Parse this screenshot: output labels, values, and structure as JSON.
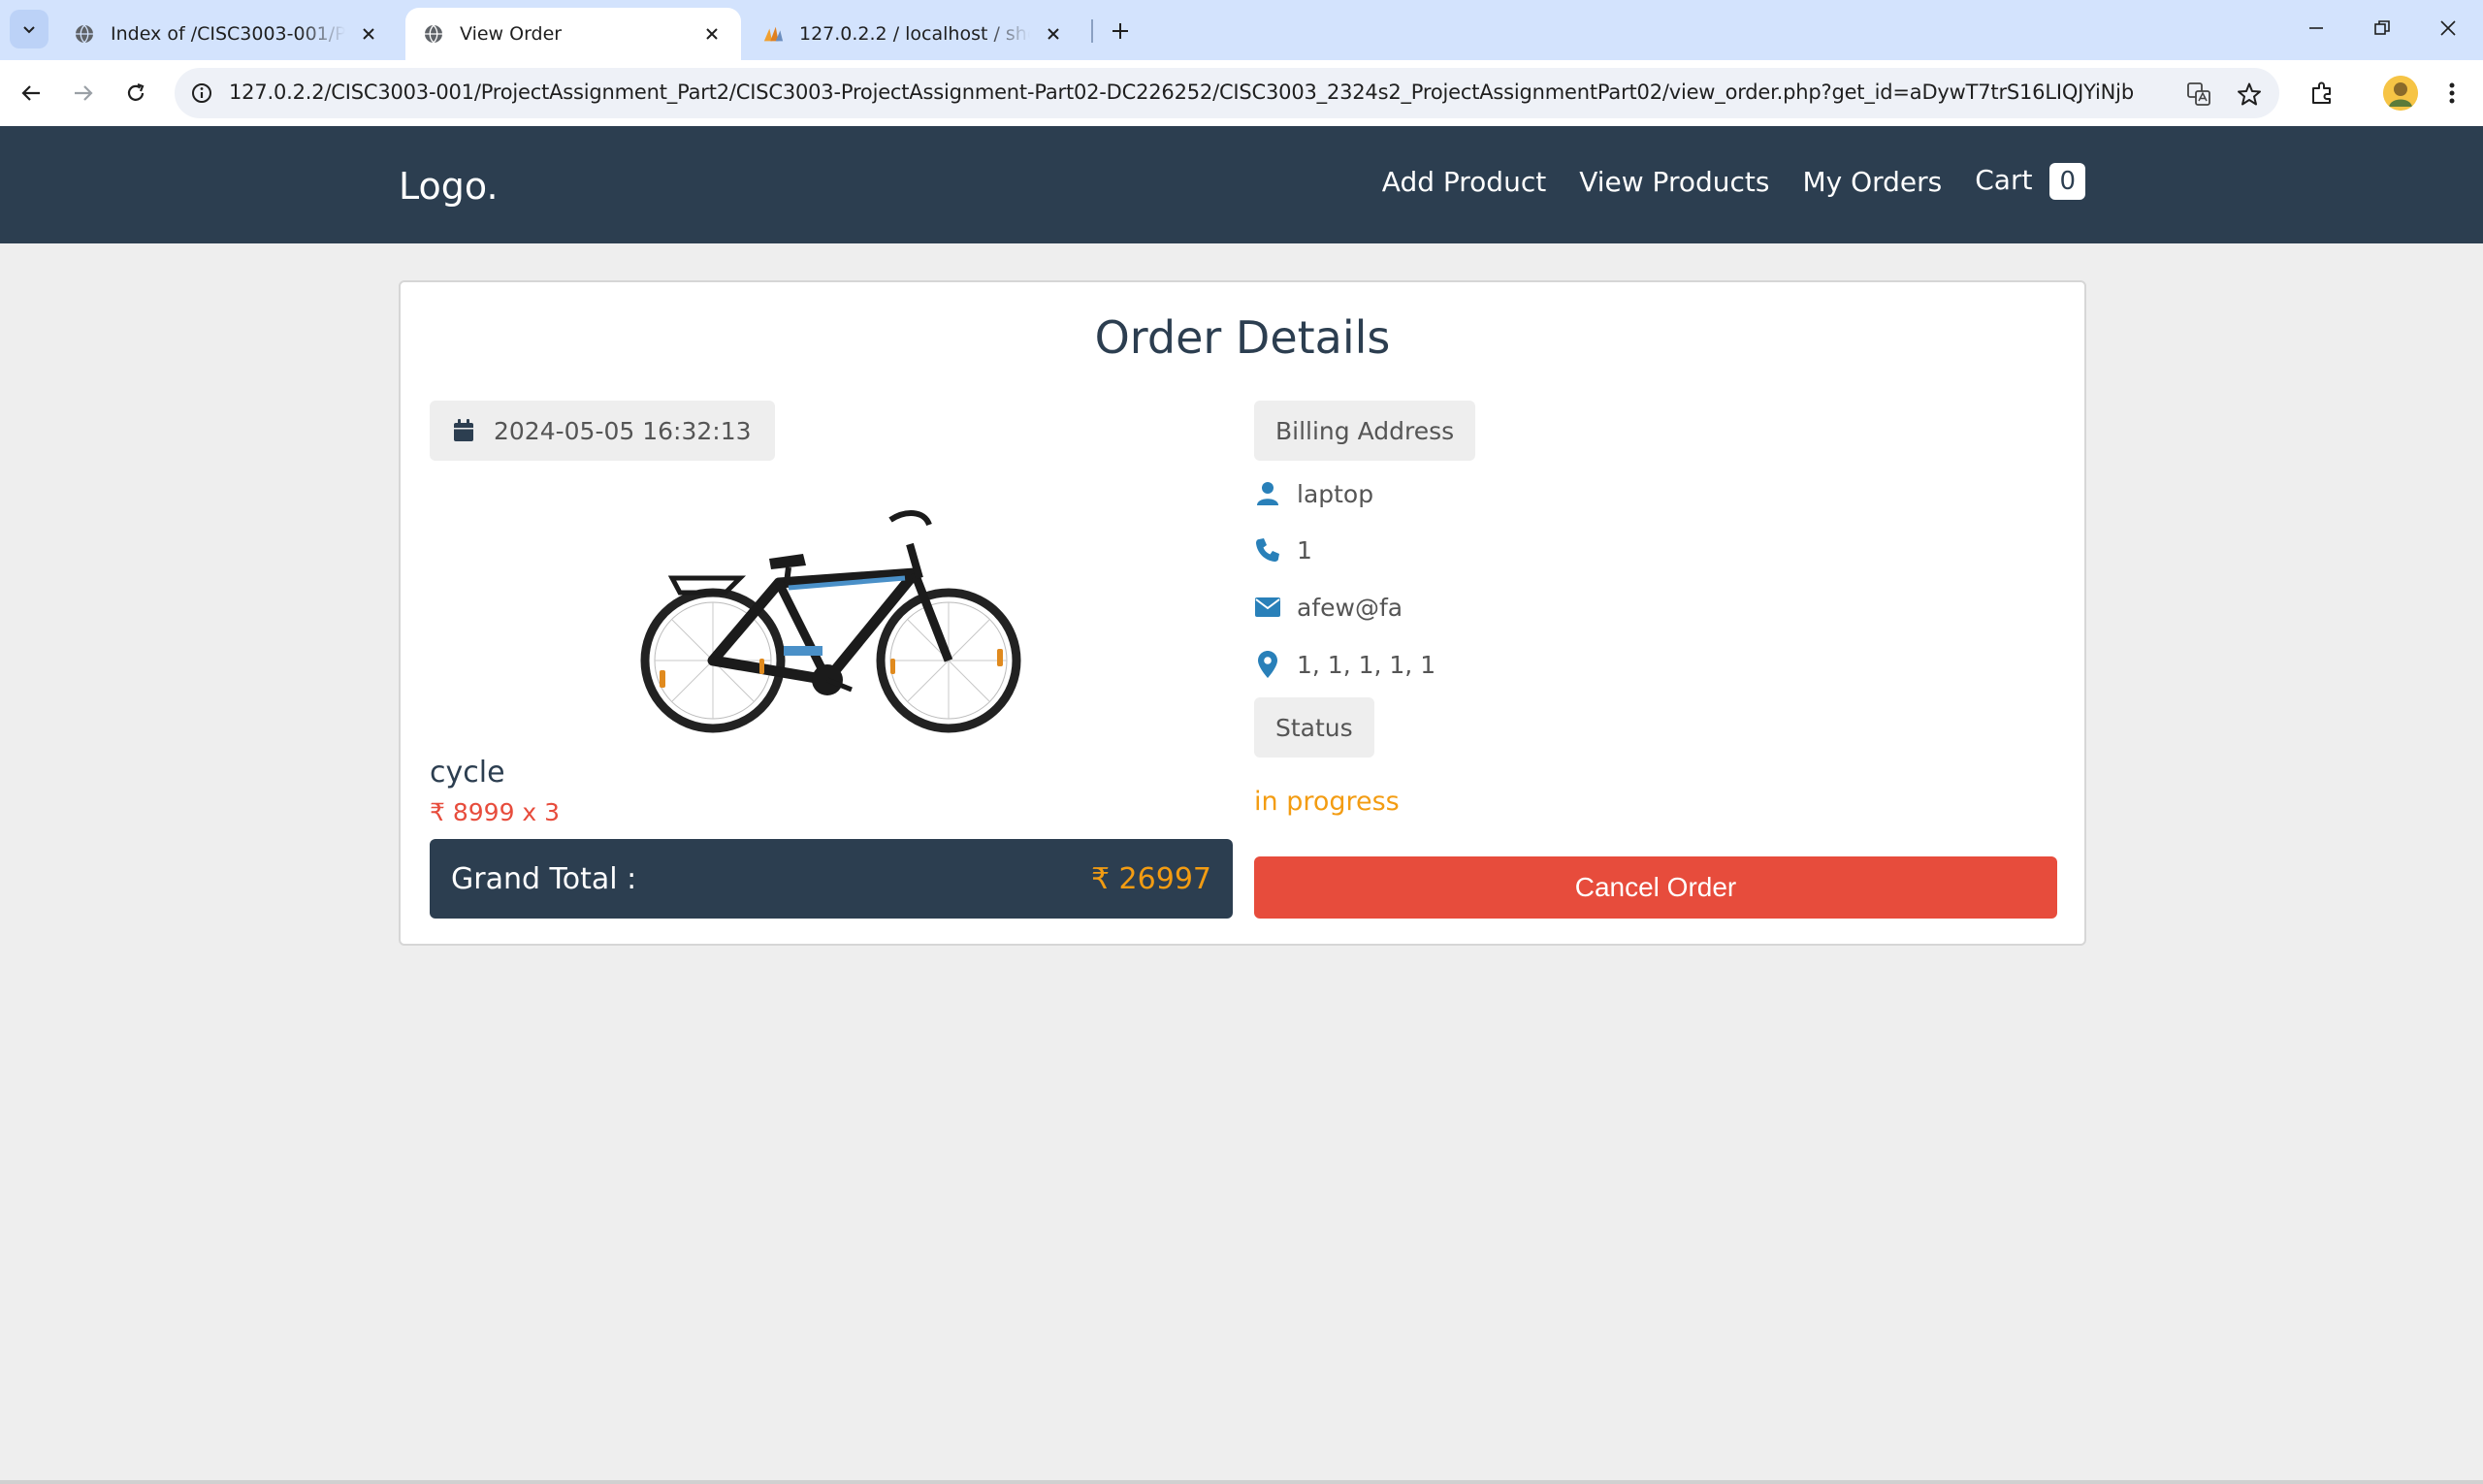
{
  "browser": {
    "tabs": [
      {
        "title": "Index of /CISC3003-001/ProjectAssignment_Part2",
        "favicon": "globe-icon",
        "active": false
      },
      {
        "title": "View Order",
        "favicon": "globe-icon",
        "active": true
      },
      {
        "title": "127.0.2.2 / localhost / shop_db",
        "favicon": "phpmyadmin-icon",
        "active": false
      }
    ],
    "url": "127.0.2.2/CISC3003-001/ProjectAssignment_Part2/CISC3003-ProjectAssignment-Part02-DC226252/CISC3003_2324s2_ProjectAssignmentPart02/view_order.php?get_id=aDywT7trS16LIQJYiNjb"
  },
  "header": {
    "logo": "Logo.",
    "nav": {
      "add_product": "Add Product",
      "view_products": "View Products",
      "my_orders": "My Orders",
      "cart": "Cart",
      "cart_count": "0"
    }
  },
  "order": {
    "title": "Order Details",
    "date": "2024-05-05 16:32:13",
    "product_name": "cycle",
    "price_line": "₹ 8999 x 3",
    "grand_total_label": "Grand Total :",
    "grand_total_value": "₹ 26997",
    "billing_label": "Billing Address",
    "name": "laptop",
    "phone": "1",
    "email": "afew@fa",
    "address": "1, 1, 1, 1, 1",
    "status_label": "Status",
    "status_value": "in progress",
    "cancel_label": "Cancel Order"
  },
  "colors": {
    "header_bg": "#2c3e50",
    "accent_orange": "#f39c12",
    "danger_red": "#e74c3c",
    "icon_blue": "#2980b9"
  }
}
